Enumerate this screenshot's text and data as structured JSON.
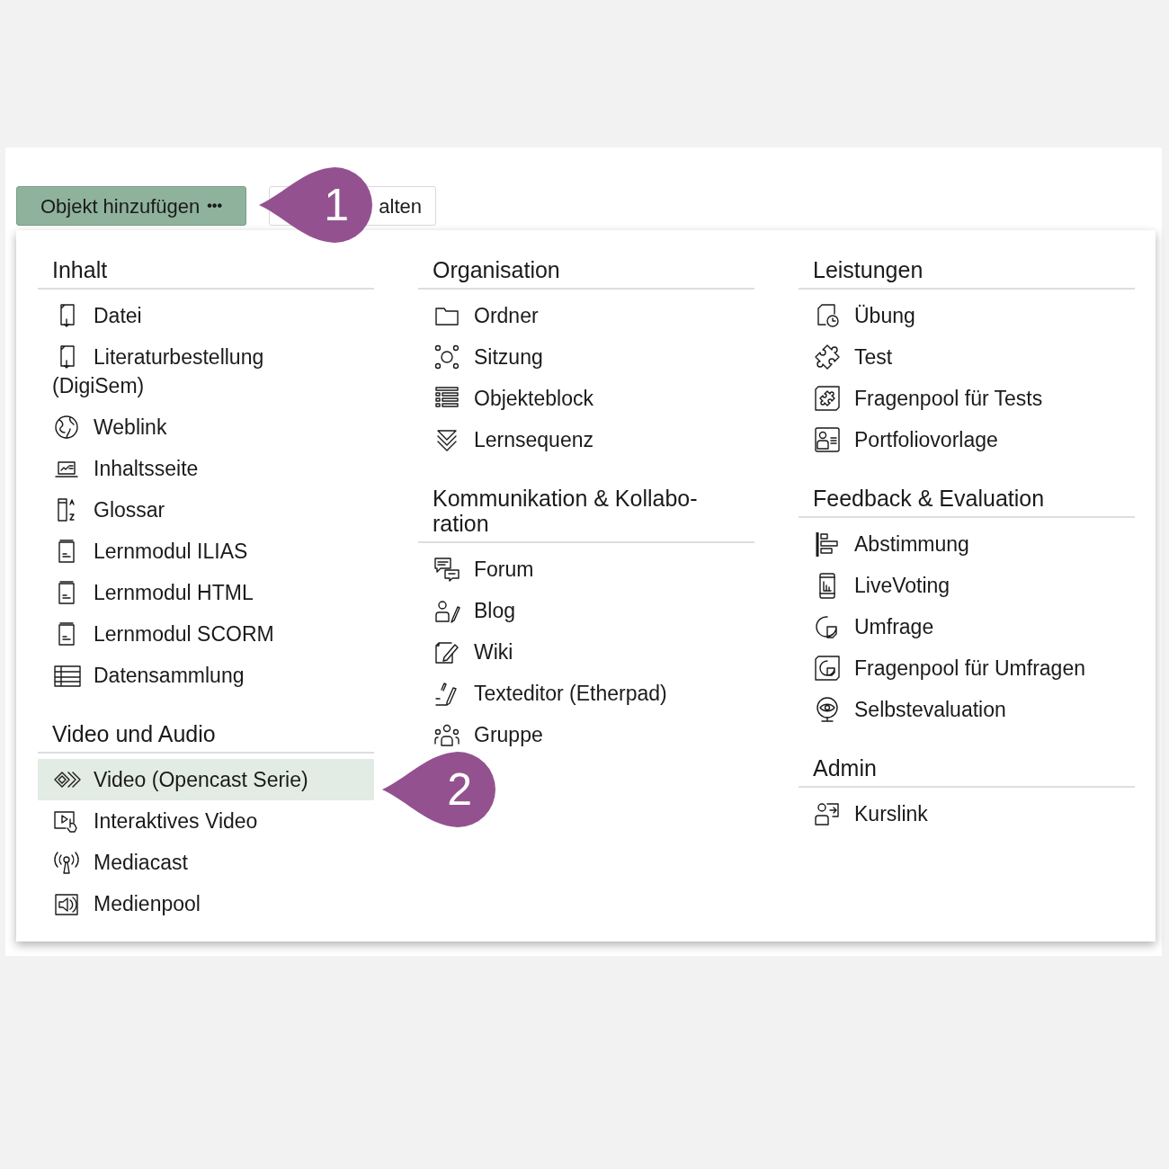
{
  "toolbar": {
    "buttons": [
      {
        "label": "Objekt hinzufügen",
        "menu_icon": "•••",
        "selected": true
      },
      {
        "label": "alten",
        "selected": false
      }
    ]
  },
  "callouts": [
    {
      "number": "1"
    },
    {
      "number": "2"
    }
  ],
  "menu": {
    "columns": [
      {
        "sections": [
          {
            "heading": "Inhalt",
            "items": [
              {
                "label": "Datei",
                "selected": false
              },
              {
                "label": "Literaturbestellung (DigiSem)",
                "selected": false
              },
              {
                "label": "Weblink",
                "selected": false
              },
              {
                "label": "Inhaltsseite",
                "selected": false
              },
              {
                "label": "Glossar",
                "selected": false
              },
              {
                "label": "Lernmodul ILIAS",
                "selected": false
              },
              {
                "label": "Lernmodul HTML",
                "selected": false
              },
              {
                "label": "Lernmodul SCORM",
                "selected": false
              },
              {
                "label": "Datensammlung",
                "selected": false
              }
            ]
          },
          {
            "heading": "Video und Audio",
            "items": [
              {
                "label": "Video (Opencast Serie)",
                "selected": true
              },
              {
                "label": "Interaktives Video",
                "selected": false
              },
              {
                "label": "Mediacast",
                "selected": false
              },
              {
                "label": "Medienpool",
                "selected": false
              }
            ]
          }
        ]
      },
      {
        "sections": [
          {
            "heading": "Organisation",
            "items": [
              {
                "label": "Ordner",
                "selected": false
              },
              {
                "label": "Sitzung",
                "selected": false
              },
              {
                "label": "Objekteblock",
                "selected": false
              },
              {
                "label": "Lernsequenz",
                "selected": false
              }
            ]
          },
          {
            "heading": "Kommunikation & Kollabo-ration",
            "items": [
              {
                "label": "Forum",
                "selected": false
              },
              {
                "label": "Blog",
                "selected": false
              },
              {
                "label": "Wiki",
                "selected": false
              },
              {
                "label": "Texteditor (Etherpad)",
                "selected": false
              },
              {
                "label": "Gruppe",
                "selected": false
              }
            ]
          }
        ]
      },
      {
        "sections": [
          {
            "heading": "Leistungen",
            "items": [
              {
                "label": "Übung",
                "selected": false
              },
              {
                "label": "Test",
                "selected": false
              },
              {
                "label": "Fragenpool für Tests",
                "selected": false
              },
              {
                "label": "Portfoliovorlage",
                "selected": false
              }
            ]
          },
          {
            "heading": "Feedback & Evaluation",
            "items": [
              {
                "label": "Abstimmung",
                "selected": false
              },
              {
                "label": "LiveVoting",
                "selected": false
              },
              {
                "label": "Umfrage",
                "selected": false
              },
              {
                "label": "Fragenpool für Umfragen",
                "selected": false
              },
              {
                "label": "Selbstevaluation",
                "selected": false
              }
            ]
          },
          {
            "heading": "Admin",
            "items": [
              {
                "label": "Kurslink",
                "selected": false
              }
            ]
          }
        ]
      }
    ]
  }
}
